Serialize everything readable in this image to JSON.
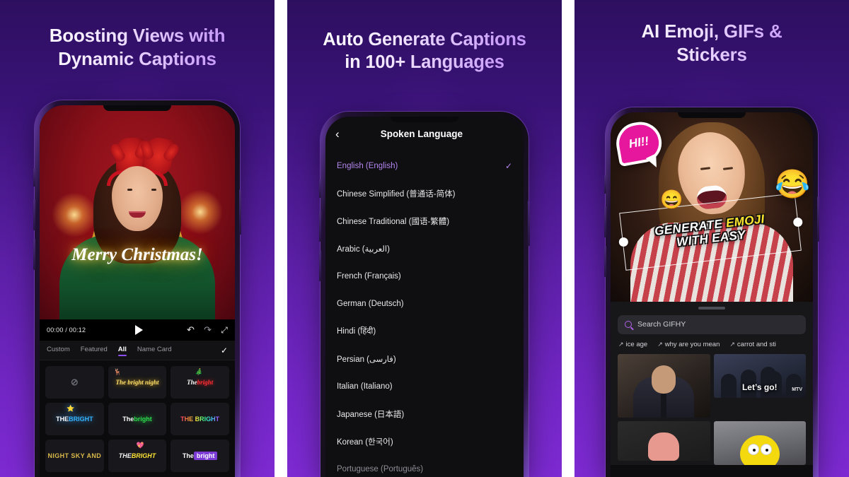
{
  "theme": {
    "bg_top": "#2d0f5f",
    "bg_bottom": "#7d2ad2",
    "accent": "#8b4ff0",
    "headline_gradient_start": "#ffffff",
    "headline_gradient_end": "#bb8cf7"
  },
  "panels": [
    {
      "headline_line1": "Boosting Views with",
      "headline_line2": "Dynamic Captions",
      "video": {
        "caption_overlay": "Merry Christmas!",
        "player": {
          "time": "00:00 / 00:12",
          "play_label": "▶",
          "undo_label": "↶",
          "redo_label": "↷",
          "expand_label": "⤢"
        }
      },
      "tabs": [
        {
          "label": "Custom",
          "active": false
        },
        {
          "label": "Featured",
          "active": false
        },
        {
          "label": "All",
          "active": true
        },
        {
          "label": "Name Card",
          "active": false
        }
      ],
      "confirm_label": "✓",
      "caption_styles": [
        {
          "id": "none",
          "label": "⊘",
          "kind": "none"
        },
        {
          "id": "bright-night-gold",
          "label": "The bright night",
          "kind": "gold",
          "emoji": "🦌"
        },
        {
          "id": "bright-red",
          "label_white": "The ",
          "label_accent": "bright",
          "kind": "red",
          "emoji": "🎄"
        },
        {
          "id": "the-bright-blue",
          "label_white": "THE ",
          "label_accent": "BRIGHT",
          "kind": "blue",
          "emoji": "⭐"
        },
        {
          "id": "the-bright-green",
          "label_white": "The ",
          "label_accent": "bright",
          "kind": "green"
        },
        {
          "id": "the-bright-rainbow",
          "label": "THE BRIGHT",
          "kind": "rainbow"
        },
        {
          "id": "night-sky-and",
          "label": "NIGHT SKY AND",
          "kind": "nightsky"
        },
        {
          "id": "the-bright-yellow",
          "label_white": "THE ",
          "label_accent": "BRIGHT",
          "kind": "yellow",
          "emoji": "💖"
        },
        {
          "id": "the-bright-highlight",
          "label_white": "The ",
          "label_accent": "bright",
          "kind": "highlight"
        }
      ]
    },
    {
      "headline_line1": "Auto Generate Captions",
      "headline_line2": "in 100+ Languages",
      "nav": {
        "back_label": "‹",
        "title": "Spoken Language"
      },
      "selected_tick": "✓",
      "languages": [
        {
          "name": "English (English)",
          "selected": true
        },
        {
          "name": "Chinese Simplified (普通话-简体)",
          "selected": false
        },
        {
          "name": "Chinese Traditional (國语-繁體)",
          "selected": false
        },
        {
          "name": "Arabic (العربية)",
          "selected": false
        },
        {
          "name": "French (Français)",
          "selected": false
        },
        {
          "name": "German (Deutsch)",
          "selected": false
        },
        {
          "name": "Hindi (हिंदी)",
          "selected": false
        },
        {
          "name": "Persian (فارسی)",
          "selected": false
        },
        {
          "name": "Italian (Italiano)",
          "selected": false
        },
        {
          "name": "Japanese (日本語)",
          "selected": false
        },
        {
          "name": "Korean (한국어)",
          "selected": false
        },
        {
          "name": "Portuguese (Português)",
          "selected": false
        }
      ]
    },
    {
      "headline_line1": "AI Emoji, GIFs &",
      "headline_line2": "Stickers",
      "stickers": {
        "hi_label": "HI!!",
        "laugh_emoji": "😂",
        "smile_emoji": "😄"
      },
      "overlay_text": {
        "line1_plain": "GENERATE ",
        "line1_highlight": "EMOJI",
        "line2": "WITH EASY"
      },
      "search": {
        "placeholder": "Search GIFHY",
        "value": ""
      },
      "trending": [
        {
          "label": "ice age"
        },
        {
          "label": "why are you mean"
        },
        {
          "label": "carrot and sti"
        }
      ],
      "gifs": [
        {
          "id": "man-suit",
          "caption": ""
        },
        {
          "id": "lets-go",
          "caption": "Let’s go!",
          "watermark": "MTV"
        },
        {
          "id": "patrick",
          "caption": ""
        },
        {
          "id": "homer",
          "caption": ""
        }
      ]
    }
  ]
}
